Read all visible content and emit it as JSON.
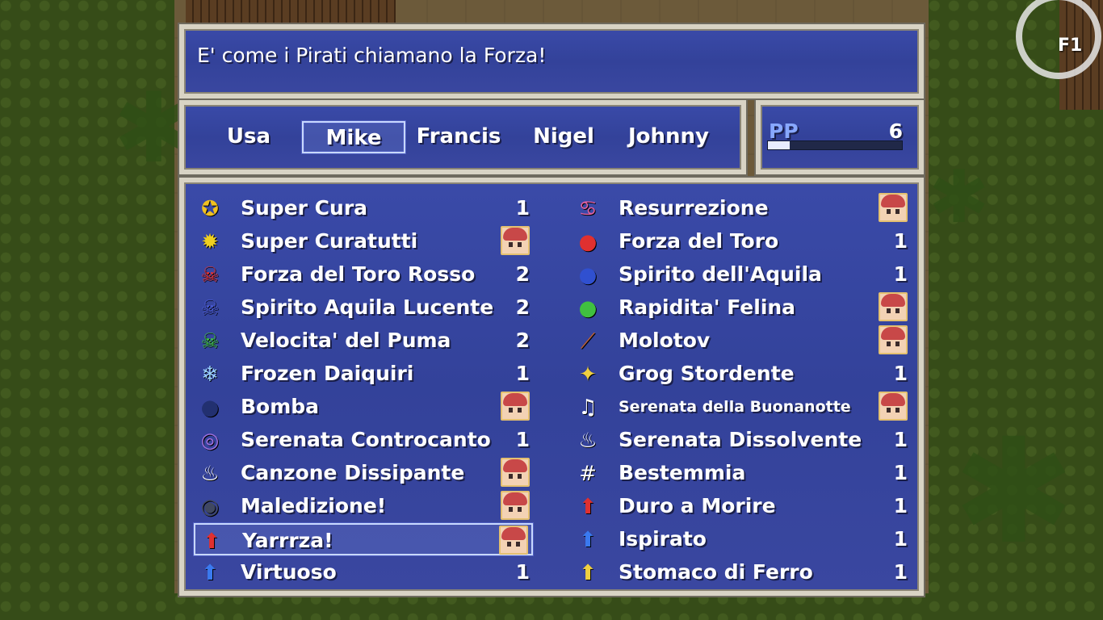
{
  "help_text": "E' come i Pirati chiamano la Forza!",
  "f1_label": "F1",
  "actors": [
    "Usa",
    "Mike",
    "Francis",
    "Nigel",
    "Johnny"
  ],
  "selected_actor": "Mike",
  "pp": {
    "label": "PP",
    "value": "6",
    "fill_fraction": 0.16
  },
  "items_left": [
    {
      "name": "Super Cura",
      "icon": "✪",
      "icon_name": "heal-icon",
      "icon_color": "#f0c020",
      "qty": "1"
    },
    {
      "name": "Super Curatutti",
      "icon": "✹",
      "icon_name": "heal-all-icon",
      "icon_color": "#f0d020",
      "qty": null
    },
    {
      "name": "Forza del Toro Rosso",
      "icon": "☠",
      "icon_name": "red-skull-potion-icon",
      "icon_color": "#e03030",
      "qty": "2"
    },
    {
      "name": "Spirito Aquila Lucente",
      "icon": "☠",
      "icon_name": "blue-skull-potion-icon",
      "icon_color": "#4a5ad0",
      "qty": "2"
    },
    {
      "name": "Velocita' del Puma",
      "icon": "☠",
      "icon_name": "green-skull-potion-icon",
      "icon_color": "#40c040",
      "qty": "2"
    },
    {
      "name": "Frozen Daiquiri",
      "icon": "❄",
      "icon_name": "daiquiri-icon",
      "icon_color": "#9ad0ff",
      "qty": "1"
    },
    {
      "name": "Bomba",
      "icon": "●",
      "icon_name": "bomb-icon",
      "icon_color": "#223070",
      "qty": null
    },
    {
      "name": "Serenata Controcanto",
      "icon": "◎",
      "icon_name": "swirl-icon",
      "icon_color": "#a070e0",
      "qty": "1"
    },
    {
      "name": "Canzone Dissipante",
      "icon": "♨",
      "icon_name": "dispel-song-icon",
      "icon_color": "#ffffff",
      "qty": null
    },
    {
      "name": "Maledizione!",
      "icon": "◉",
      "icon_name": "curse-icon",
      "icon_color": "#404860",
      "qty": null
    },
    {
      "name": "Yarrrza!",
      "icon": "⬆",
      "icon_name": "str-up-icon",
      "icon_color": "#e03030",
      "qty": null
    },
    {
      "name": "Virtuoso",
      "icon": "⬆",
      "icon_name": "spi-up-icon",
      "icon_color": "#3a7af0",
      "qty": "1"
    }
  ],
  "items_right": [
    {
      "name": "Resurrezione",
      "icon": "♋",
      "icon_name": "resurrect-icon",
      "icon_color": "#e060a0",
      "qty": null
    },
    {
      "name": "Forza del Toro",
      "icon": "●",
      "icon_name": "red-potion-icon",
      "icon_color": "#e03030",
      "qty": "1"
    },
    {
      "name": "Spirito dell'Aquila",
      "icon": "●",
      "icon_name": "blue-potion-icon",
      "icon_color": "#3050d0",
      "qty": "1"
    },
    {
      "name": "Rapidita' Felina",
      "icon": "●",
      "icon_name": "green-potion-icon",
      "icon_color": "#40c040",
      "qty": null
    },
    {
      "name": "Molotov",
      "icon": "⟋",
      "icon_name": "molotov-icon",
      "icon_color": "#c06030",
      "qty": null
    },
    {
      "name": "Grog Stordente",
      "icon": "✦",
      "icon_name": "grog-icon",
      "icon_color": "#f0d040",
      "qty": "1"
    },
    {
      "name": "Serenata della Buonanotte",
      "icon": "♫",
      "icon_name": "sleep-song-icon",
      "icon_color": "#ffffff",
      "qty": null,
      "small": true
    },
    {
      "name": "Serenata Dissolvente",
      "icon": "♨",
      "icon_name": "dissolve-song-icon",
      "icon_color": "#ffffff",
      "qty": "1"
    },
    {
      "name": "Bestemmia",
      "icon": "#",
      "icon_name": "curse-word-icon",
      "icon_color": "#ffffff",
      "qty": "1"
    },
    {
      "name": "Duro a Morire",
      "icon": "⬆",
      "icon_name": "hp-up-icon",
      "icon_color": "#e03030",
      "qty": "1"
    },
    {
      "name": "Ispirato",
      "icon": "⬆",
      "icon_name": "mp-up-icon",
      "icon_color": "#3a7af0",
      "qty": "1"
    },
    {
      "name": "Stomaco di Ferro",
      "icon": "⬆",
      "icon_name": "res-up-icon",
      "icon_color": "#f0d040",
      "qty": "1"
    }
  ],
  "selected_item": "Yarrrza!"
}
